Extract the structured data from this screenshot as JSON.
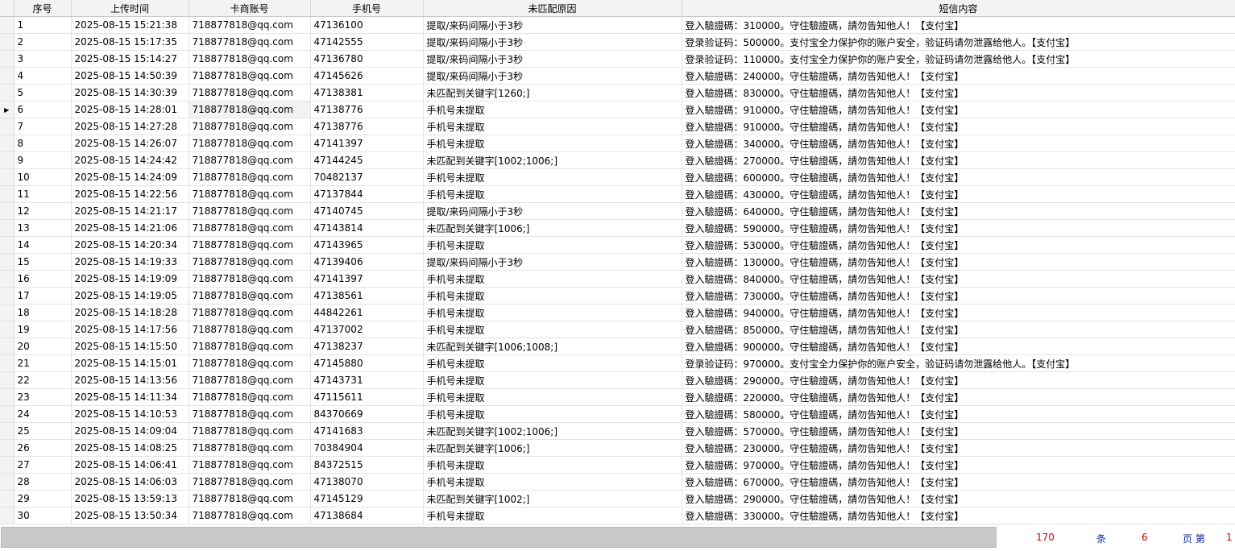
{
  "columns": [
    "序号",
    "上传时间",
    "卡商账号",
    "手机号",
    "未匹配原因",
    "短信内容"
  ],
  "selected_row": 6,
  "rows": [
    [
      "1",
      "2025-08-15 15:21:38",
      "718877818@qq.com",
      "47136100",
      "提取/来码间隔小于3秒",
      "登入驗證碼：310000。守住驗證碼，請勿告知他人！【支付宝】"
    ],
    [
      "2",
      "2025-08-15 15:17:35",
      "718877818@qq.com",
      "47142555",
      "提取/来码间隔小于3秒",
      "登录验证码：500000。支付宝全力保护你的账户安全，验证码请勿泄露给他人。【支付宝】"
    ],
    [
      "3",
      "2025-08-15 15:14:27",
      "718877818@qq.com",
      "47136780",
      "提取/来码间隔小于3秒",
      "登录验证码：110000。支付宝全力保护你的账户安全，验证码请勿泄露给他人。【支付宝】"
    ],
    [
      "4",
      "2025-08-15 14:50:39",
      "718877818@qq.com",
      "47145626",
      "提取/来码间隔小于3秒",
      "登入驗證碼：240000。守住驗證碼，請勿告知他人！【支付宝】"
    ],
    [
      "5",
      "2025-08-15 14:30:39",
      "718877818@qq.com",
      "47138381",
      "未匹配到关键字[1260;]",
      "登入驗證碼：830000。守住驗證碼，請勿告知他人！【支付宝】"
    ],
    [
      "6",
      "2025-08-15 14:28:01",
      "718877818@qq.com",
      "47138776",
      "手机号未提取",
      "登入驗證碼：910000。守住驗證碼，請勿告知他人！【支付宝】"
    ],
    [
      "7",
      "2025-08-15 14:27:28",
      "718877818@qq.com",
      "47138776",
      "手机号未提取",
      "登入驗證碼：910000。守住驗證碼，請勿告知他人！【支付宝】"
    ],
    [
      "8",
      "2025-08-15 14:26:07",
      "718877818@qq.com",
      "47141397",
      "手机号未提取",
      "登入驗證碼：340000。守住驗證碼，請勿告知他人！【支付宝】"
    ],
    [
      "9",
      "2025-08-15 14:24:42",
      "718877818@qq.com",
      "47144245",
      "未匹配到关键字[1002;1006;]",
      "登入驗證碼：270000。守住驗證碼，請勿告知他人！【支付宝】"
    ],
    [
      "10",
      "2025-08-15 14:24:09",
      "718877818@qq.com",
      "70482137",
      "手机号未提取",
      "登入驗證碼：600000。守住驗證碼，請勿告知他人！【支付宝】"
    ],
    [
      "11",
      "2025-08-15 14:22:56",
      "718877818@qq.com",
      "47137844",
      "手机号未提取",
      "登入驗證碼：430000。守住驗證碼，請勿告知他人！【支付宝】"
    ],
    [
      "12",
      "2025-08-15 14:21:17",
      "718877818@qq.com",
      "47140745",
      "提取/来码间隔小于3秒",
      "登入驗證碼：640000。守住驗證碼，請勿告知他人！【支付宝】"
    ],
    [
      "13",
      "2025-08-15 14:21:06",
      "718877818@qq.com",
      "47143814",
      "未匹配到关键字[1006;]",
      "登入驗證碼：590000。守住驗證碼，請勿告知他人！【支付宝】"
    ],
    [
      "14",
      "2025-08-15 14:20:34",
      "718877818@qq.com",
      "47143965",
      "手机号未提取",
      "登入驗證碼：530000。守住驗證碼，請勿告知他人！【支付宝】"
    ],
    [
      "15",
      "2025-08-15 14:19:33",
      "718877818@qq.com",
      "47139406",
      "提取/来码间隔小于3秒",
      "登入驗證碼：130000。守住驗證碼，請勿告知他人！【支付宝】"
    ],
    [
      "16",
      "2025-08-15 14:19:09",
      "718877818@qq.com",
      "47141397",
      "手机号未提取",
      "登入驗證碼：840000。守住驗證碼，請勿告知他人！【支付宝】"
    ],
    [
      "17",
      "2025-08-15 14:19:05",
      "718877818@qq.com",
      "47138561",
      "手机号未提取",
      "登入驗證碼：730000。守住驗證碼，請勿告知他人！【支付宝】"
    ],
    [
      "18",
      "2025-08-15 14:18:28",
      "718877818@qq.com",
      "44842261",
      "手机号未提取",
      "登入驗證碼：940000。守住驗證碼，請勿告知他人！【支付宝】"
    ],
    [
      "19",
      "2025-08-15 14:17:56",
      "718877818@qq.com",
      "47137002",
      "手机号未提取",
      "登入驗證碼：850000。守住驗證碼，請勿告知他人！【支付宝】"
    ],
    [
      "20",
      "2025-08-15 14:15:50",
      "718877818@qq.com",
      "47138237",
      "未匹配到关键字[1006;1008;]",
      "登入驗證碼：900000。守住驗證碼，請勿告知他人！【支付宝】"
    ],
    [
      "21",
      "2025-08-15 14:15:01",
      "718877818@qq.com",
      "47145880",
      "手机号未提取",
      "登录验证码：970000。支付宝全力保护你的账户安全，验证码请勿泄露给他人。【支付宝】"
    ],
    [
      "22",
      "2025-08-15 14:13:56",
      "718877818@qq.com",
      "47143731",
      "手机号未提取",
      "登入驗證碼：290000。守住驗證碼，請勿告知他人！【支付宝】"
    ],
    [
      "23",
      "2025-08-15 14:11:34",
      "718877818@qq.com",
      "47115611",
      "手机号未提取",
      "登入驗證碼：220000。守住驗證碼，請勿告知他人！【支付宝】"
    ],
    [
      "24",
      "2025-08-15 14:10:53",
      "718877818@qq.com",
      "84370669",
      "手机号未提取",
      "登入驗證碼：580000。守住驗證碼，請勿告知他人！【支付宝】"
    ],
    [
      "25",
      "2025-08-15 14:09:04",
      "718877818@qq.com",
      "47141683",
      "未匹配到关键字[1002;1006;]",
      "登入驗證碼：570000。守住驗證碼，請勿告知他人！【支付宝】"
    ],
    [
      "26",
      "2025-08-15 14:08:25",
      "718877818@qq.com",
      "70384904",
      "未匹配到关键字[1006;]",
      "登入驗證碼：230000。守住驗證碼，請勿告知他人！【支付宝】"
    ],
    [
      "27",
      "2025-08-15 14:06:41",
      "718877818@qq.com",
      "84372515",
      "手机号未提取",
      "登入驗證碼：970000。守住驗證碼，請勿告知他人！【支付宝】"
    ],
    [
      "28",
      "2025-08-15 14:06:03",
      "718877818@qq.com",
      "47138070",
      "手机号未提取",
      "登入驗證碼：670000。守住驗證碼，請勿告知他人！【支付宝】"
    ],
    [
      "29",
      "2025-08-15 13:59:13",
      "718877818@qq.com",
      "47145129",
      "未匹配到关键字[1002;]",
      "登入驗證碼：290000。守住驗證碼，請勿告知他人！【支付宝】"
    ],
    [
      "30",
      "2025-08-15 13:50:34",
      "718877818@qq.com",
      "47138684",
      "手机号未提取",
      "登入驗證碼：330000。守住驗證碼，請勿告知他人！【支付宝】"
    ]
  ],
  "pager": {
    "total": "170",
    "total_unit": "条",
    "pages": "6",
    "page_label": "页 第",
    "current": "1"
  },
  "colors": {
    "pager_number": "#cc0000",
    "pager_label": "#0a2a9a"
  }
}
